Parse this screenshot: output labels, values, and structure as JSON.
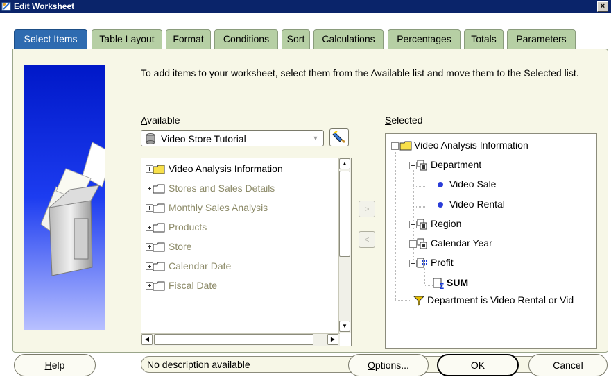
{
  "window": {
    "title": "Edit Worksheet",
    "close_glyph": "×"
  },
  "tabs": [
    {
      "label": "Select Items",
      "active": true
    },
    {
      "label": "Table Layout"
    },
    {
      "label": "Format"
    },
    {
      "label": "Conditions"
    },
    {
      "label": "Sort"
    },
    {
      "label": "Calculations"
    },
    {
      "label": "Percentages"
    },
    {
      "label": "Totals"
    },
    {
      "label": "Parameters"
    }
  ],
  "instructions": "To add items to your worksheet, select them from the Available list and move them to the Selected list.",
  "available": {
    "label_accel": "A",
    "label_rest": "vailable",
    "dropdown_value": "Video Store Tutorial",
    "items": [
      {
        "label": "Video Analysis Information",
        "muted": false,
        "icon": "folder-yellow-icon"
      },
      {
        "label": "Stores and Sales Details",
        "muted": true,
        "icon": "folder-icon"
      },
      {
        "label": "Monthly Sales Analysis",
        "muted": true,
        "icon": "folder-icon"
      },
      {
        "label": "Products",
        "muted": true,
        "icon": "folder-icon"
      },
      {
        "label": "Store",
        "muted": true,
        "icon": "folder-icon"
      },
      {
        "label": "Calendar Date",
        "muted": true,
        "icon": "folder-icon"
      },
      {
        "label": "Fiscal Date",
        "muted": true,
        "icon": "folder-icon"
      }
    ]
  },
  "move_buttons": {
    "add_glyph": ">",
    "remove_glyph": "<"
  },
  "selected": {
    "label_accel": "S",
    "label_rest": "elected",
    "items": [
      {
        "label": "Video Analysis Information",
        "icon": "folder-yellow-icon"
      },
      {
        "label": "Department",
        "icon": "dimension-icon"
      },
      {
        "label": "Video Sale",
        "icon": "bullet-icon"
      },
      {
        "label": "Video Rental",
        "icon": "bullet-icon"
      },
      {
        "label": "Region",
        "icon": "dimension-icon"
      },
      {
        "label": "Calendar Year",
        "icon": "dimension-icon"
      },
      {
        "label": "Profit",
        "icon": "measure-icon"
      },
      {
        "label": "SUM",
        "icon": "sum-icon",
        "bold": true
      },
      {
        "label": "Department is Video Rental or Vid",
        "icon": "filter-icon"
      }
    ]
  },
  "description": "No description available",
  "buttons": {
    "help_accel": "H",
    "help_rest": "elp",
    "options_accel": "O",
    "options_rest": "ptions...",
    "ok": "OK",
    "cancel": "Cancel"
  },
  "colors": {
    "titlebar": "#0a246a",
    "tab_active": "#2e6bb0",
    "tab_inactive": "#b6cfa4",
    "panel": "#f7f7e7",
    "muted_text": "#8c8a68"
  }
}
